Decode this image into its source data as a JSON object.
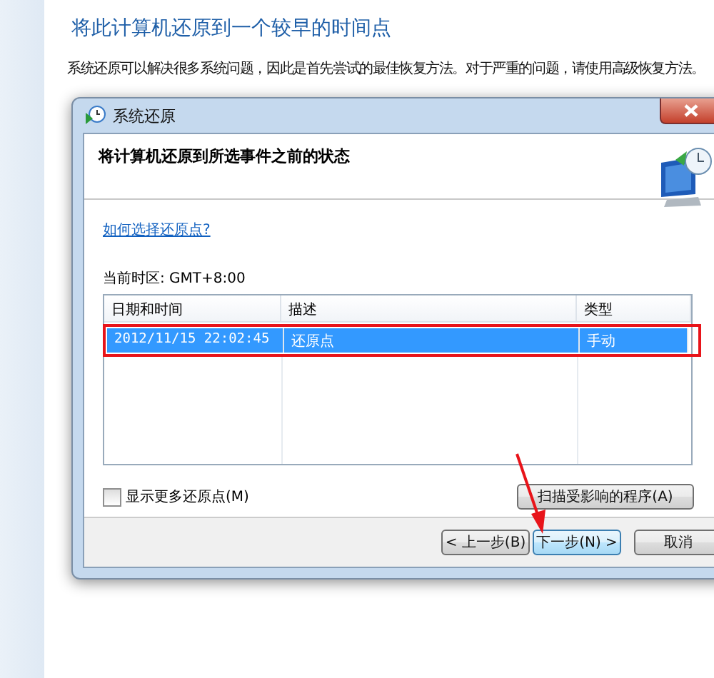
{
  "page": {
    "title": "将此计算机还原到一个较早的时间点",
    "description": "系统还原可以解决很多系统问题，因此是首先尝试的最佳恢复方法。对于严重的问题，请使用高级恢复方法。"
  },
  "dialog": {
    "title": "系统还原",
    "heading": "将计算机还原到所选事件之前的状态",
    "help_link": "如何选择还原点?",
    "timezone": "当前时区: GMT+8:00",
    "table": {
      "columns": [
        "日期和时间",
        "描述",
        "类型"
      ],
      "rows": [
        {
          "cells": [
            "2012/11/15 22:02:45",
            "还原点",
            "手动"
          ],
          "selected": true
        }
      ]
    },
    "show_more": {
      "label": "显示更多还原点(M)",
      "checked": false
    },
    "scan_button": "扫描受影响的程序(A)",
    "buttons": [
      {
        "label": "< 上一步(B)",
        "focused": false
      },
      {
        "label": "下一步(N) >",
        "focused": true
      },
      {
        "label": "取消",
        "focused": false
      }
    ]
  }
}
